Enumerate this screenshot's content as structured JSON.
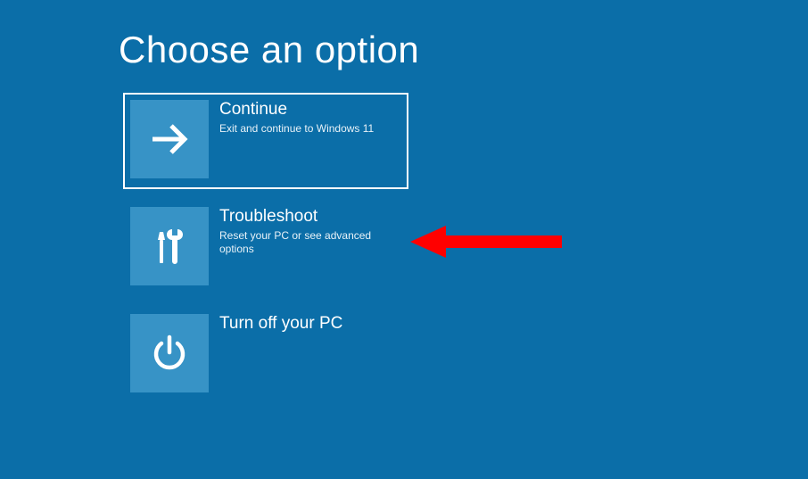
{
  "header": {
    "title": "Choose an option"
  },
  "options": [
    {
      "title": "Continue",
      "desc": "Exit and continue to Windows 11"
    },
    {
      "title": "Troubleshoot",
      "desc": "Reset your PC or see advanced options"
    },
    {
      "title": "Turn off your PC",
      "desc": ""
    }
  ]
}
